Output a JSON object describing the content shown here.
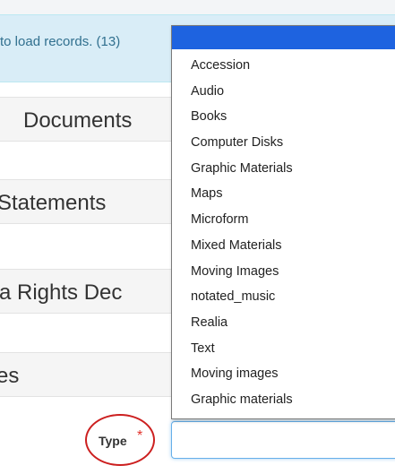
{
  "alert": {
    "text": "to load records. (13)"
  },
  "sections": [
    {
      "title": "Documents"
    },
    {
      "title": "Statements"
    },
    {
      "title": "a Rights Dec"
    },
    {
      "title": "es"
    }
  ],
  "form": {
    "type_label": "Type",
    "required_marker": "*",
    "type_value": ""
  },
  "dropdown": {
    "selected": "",
    "options": [
      "Accession",
      "Audio",
      "Books",
      "Computer Disks",
      "Graphic Materials",
      "Maps",
      "Microform",
      "Mixed Materials",
      "Moving Images",
      "notated_music",
      "Realia",
      "Text",
      "Moving images",
      "Graphic materials"
    ]
  },
  "colors": {
    "alert_bg": "#d9edf7",
    "selected_option": "#1e63e0",
    "annotation_circle": "#cc1f1f",
    "required": "#e2322b"
  }
}
